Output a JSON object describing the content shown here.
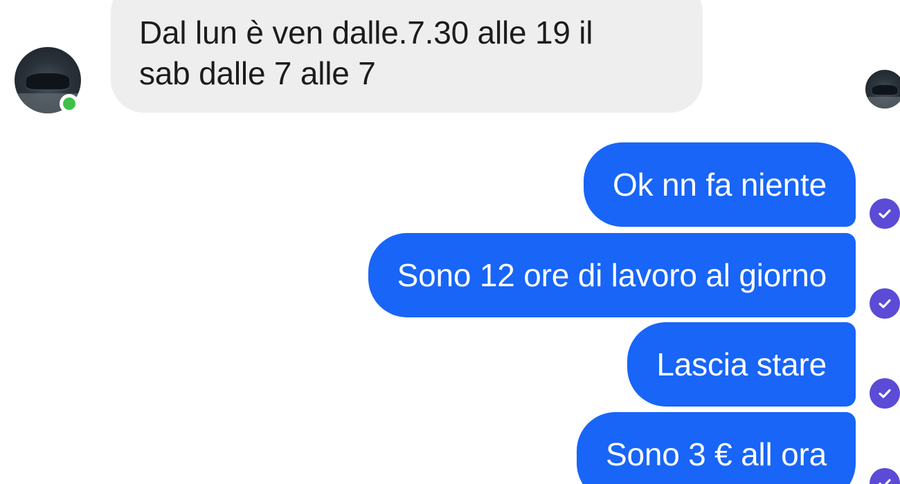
{
  "conversation": {
    "incoming": {
      "text": "Dal lun è ven dalle.7.30 alle 19 il sab dalle 7 alle 7",
      "line1": "Dal lun è ven dalle.7.30 alle 19 il",
      "line2": "sab dalle 7 alle 7",
      "sender_status": "online"
    },
    "outgoing": [
      {
        "text": "Ok nn fa niente",
        "status": "read"
      },
      {
        "text": "Sono 12 ore di lavoro al giorno",
        "status": "read"
      },
      {
        "text": "Lascia stare",
        "status": "read"
      },
      {
        "text": "Sono 3 € all ora",
        "status": "read"
      }
    ]
  },
  "colors": {
    "outgoing_bubble": "#1865f7",
    "incoming_bubble": "#eeeeef",
    "read_check": "#5b4bd6",
    "online_dot": "#3ec14a"
  },
  "icons": {
    "read_receipt": "check-circle-icon",
    "online_indicator": "online-dot-icon"
  }
}
